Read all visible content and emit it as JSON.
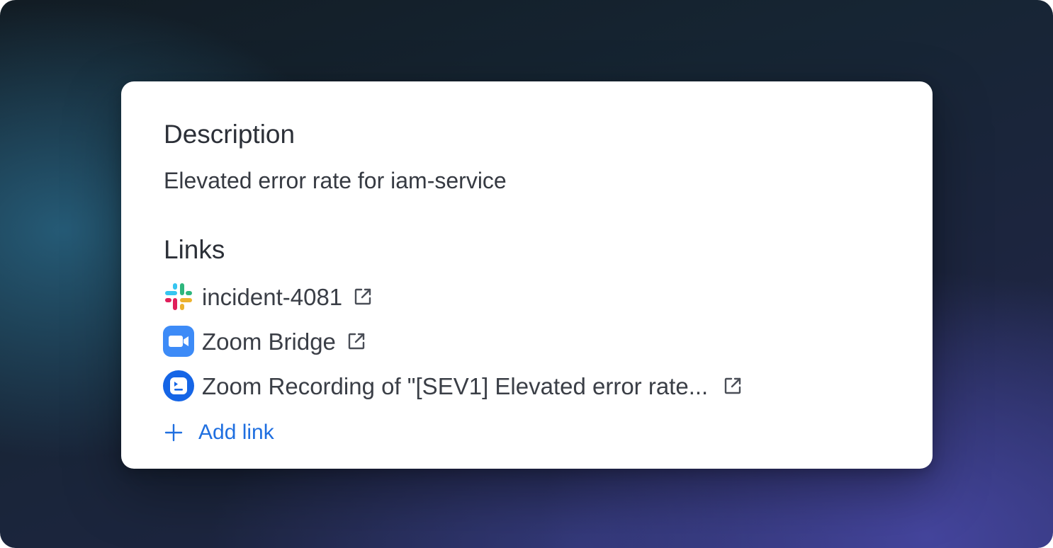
{
  "description": {
    "title": "Description",
    "text": "Elevated error rate for iam-service"
  },
  "links": {
    "title": "Links",
    "items": [
      {
        "label": "incident-4081",
        "icon": "slack-icon"
      },
      {
        "label": "Zoom Bridge",
        "icon": "zoom-video-icon"
      },
      {
        "label": "Zoom Recording of \"[SEV1] Elevated error rate...",
        "icon": "zoom-recording-icon"
      }
    ],
    "add_label": "Add link"
  },
  "colors": {
    "link_accent": "#1f6fe0",
    "zoom_blue": "#3d8bf7",
    "zoom_recording_blue": "#1565e6",
    "slack_red": "#e01e5a",
    "slack_green": "#2eb67d",
    "slack_blue": "#36c5f0",
    "slack_yellow": "#ecb22e"
  }
}
